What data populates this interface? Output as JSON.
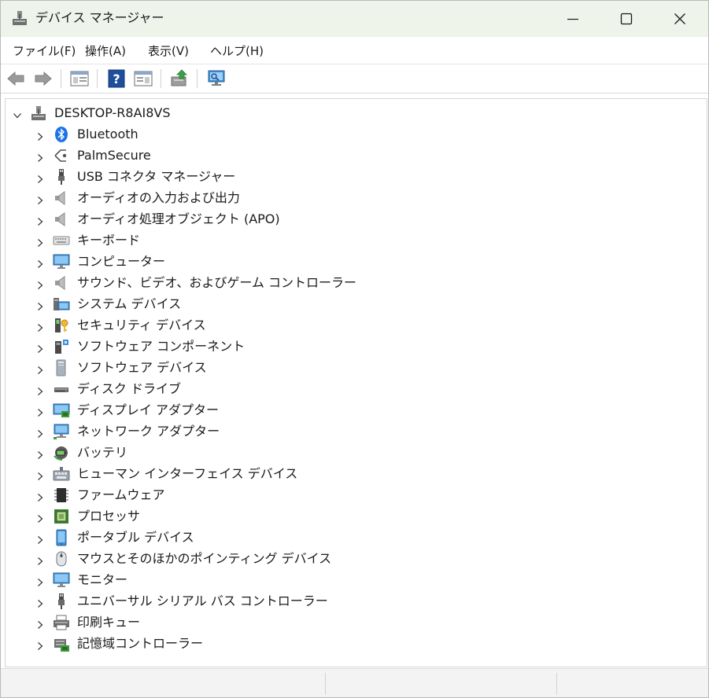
{
  "window": {
    "title": "デバイス マネージャー",
    "app_icon": "device-manager-icon"
  },
  "menu": [
    {
      "label": "ファイル(F)"
    },
    {
      "label": "操作(A)"
    },
    {
      "label": "表示(V)"
    },
    {
      "label": "ヘルプ(H)"
    }
  ],
  "toolbar": [
    {
      "name": "back-icon"
    },
    {
      "name": "forward-icon"
    },
    {
      "name": "show-hide-console-tree-icon"
    },
    {
      "name": "help-icon"
    },
    {
      "name": "properties-pane-icon"
    },
    {
      "name": "update-driver-icon"
    },
    {
      "name": "scan-hardware-changes-icon"
    }
  ],
  "tree": {
    "root": {
      "label": "DESKTOP-R8AI8VS",
      "icon": "computer-network-icon",
      "expanded": true
    },
    "categories": [
      {
        "label": "Bluetooth",
        "icon": "bluetooth-icon"
      },
      {
        "label": "PalmSecure",
        "icon": "palmsecure-icon"
      },
      {
        "label": "USB コネクタ マネージャー",
        "icon": "usb-connector-icon"
      },
      {
        "label": "オーディオの入力および出力",
        "icon": "speaker-icon"
      },
      {
        "label": "オーディオ処理オブジェクト (APO)",
        "icon": "speaker-icon"
      },
      {
        "label": "キーボード",
        "icon": "keyboard-icon"
      },
      {
        "label": "コンピューター",
        "icon": "monitor-icon"
      },
      {
        "label": "サウンド、ビデオ、およびゲーム コントローラー",
        "icon": "speaker-icon"
      },
      {
        "label": "システム デバイス",
        "icon": "system-devices-icon"
      },
      {
        "label": "セキュリティ デバイス",
        "icon": "security-key-icon"
      },
      {
        "label": "ソフトウェア コンポーネント",
        "icon": "software-component-icon"
      },
      {
        "label": "ソフトウェア デバイス",
        "icon": "software-device-icon"
      },
      {
        "label": "ディスク ドライブ",
        "icon": "disk-drive-icon"
      },
      {
        "label": "ディスプレイ アダプター",
        "icon": "display-adapter-icon"
      },
      {
        "label": "ネットワーク アダプター",
        "icon": "network-adapter-icon"
      },
      {
        "label": "バッテリ",
        "icon": "battery-icon"
      },
      {
        "label": "ヒューマン インターフェイス デバイス",
        "icon": "hid-icon"
      },
      {
        "label": "ファームウェア",
        "icon": "firmware-chip-icon"
      },
      {
        "label": "プロセッサ",
        "icon": "processor-icon"
      },
      {
        "label": "ポータブル デバイス",
        "icon": "portable-device-icon"
      },
      {
        "label": "マウスとそのほかのポインティング デバイス",
        "icon": "mouse-icon"
      },
      {
        "label": "モニター",
        "icon": "monitor-icon"
      },
      {
        "label": "ユニバーサル シリアル バス コントローラー",
        "icon": "usb-controller-icon"
      },
      {
        "label": "印刷キュー",
        "icon": "printer-icon"
      },
      {
        "label": "記憶域コントローラー",
        "icon": "storage-controller-icon"
      }
    ]
  }
}
